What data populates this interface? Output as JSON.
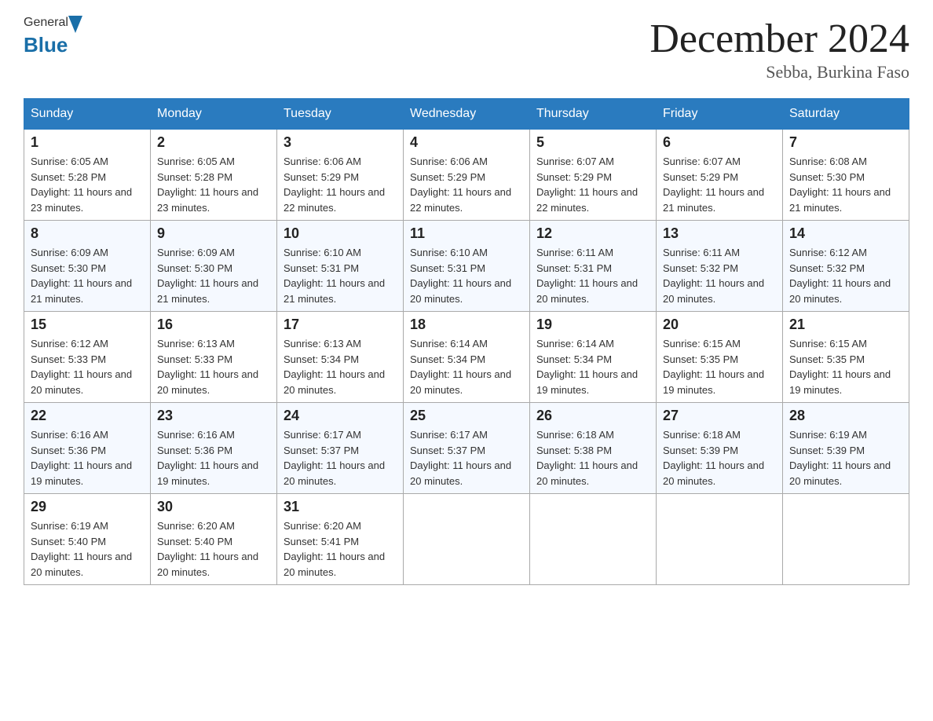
{
  "header": {
    "logo_general": "General",
    "logo_blue": "Blue",
    "month_title": "December 2024",
    "location": "Sebba, Burkina Faso"
  },
  "weekdays": [
    "Sunday",
    "Monday",
    "Tuesday",
    "Wednesday",
    "Thursday",
    "Friday",
    "Saturday"
  ],
  "weeks": [
    [
      {
        "day": "1",
        "sunrise": "Sunrise: 6:05 AM",
        "sunset": "Sunset: 5:28 PM",
        "daylight": "Daylight: 11 hours and 23 minutes."
      },
      {
        "day": "2",
        "sunrise": "Sunrise: 6:05 AM",
        "sunset": "Sunset: 5:28 PM",
        "daylight": "Daylight: 11 hours and 23 minutes."
      },
      {
        "day": "3",
        "sunrise": "Sunrise: 6:06 AM",
        "sunset": "Sunset: 5:29 PM",
        "daylight": "Daylight: 11 hours and 22 minutes."
      },
      {
        "day": "4",
        "sunrise": "Sunrise: 6:06 AM",
        "sunset": "Sunset: 5:29 PM",
        "daylight": "Daylight: 11 hours and 22 minutes."
      },
      {
        "day": "5",
        "sunrise": "Sunrise: 6:07 AM",
        "sunset": "Sunset: 5:29 PM",
        "daylight": "Daylight: 11 hours and 22 minutes."
      },
      {
        "day": "6",
        "sunrise": "Sunrise: 6:07 AM",
        "sunset": "Sunset: 5:29 PM",
        "daylight": "Daylight: 11 hours and 21 minutes."
      },
      {
        "day": "7",
        "sunrise": "Sunrise: 6:08 AM",
        "sunset": "Sunset: 5:30 PM",
        "daylight": "Daylight: 11 hours and 21 minutes."
      }
    ],
    [
      {
        "day": "8",
        "sunrise": "Sunrise: 6:09 AM",
        "sunset": "Sunset: 5:30 PM",
        "daylight": "Daylight: 11 hours and 21 minutes."
      },
      {
        "day": "9",
        "sunrise": "Sunrise: 6:09 AM",
        "sunset": "Sunset: 5:30 PM",
        "daylight": "Daylight: 11 hours and 21 minutes."
      },
      {
        "day": "10",
        "sunrise": "Sunrise: 6:10 AM",
        "sunset": "Sunset: 5:31 PM",
        "daylight": "Daylight: 11 hours and 21 minutes."
      },
      {
        "day": "11",
        "sunrise": "Sunrise: 6:10 AM",
        "sunset": "Sunset: 5:31 PM",
        "daylight": "Daylight: 11 hours and 20 minutes."
      },
      {
        "day": "12",
        "sunrise": "Sunrise: 6:11 AM",
        "sunset": "Sunset: 5:31 PM",
        "daylight": "Daylight: 11 hours and 20 minutes."
      },
      {
        "day": "13",
        "sunrise": "Sunrise: 6:11 AM",
        "sunset": "Sunset: 5:32 PM",
        "daylight": "Daylight: 11 hours and 20 minutes."
      },
      {
        "day": "14",
        "sunrise": "Sunrise: 6:12 AM",
        "sunset": "Sunset: 5:32 PM",
        "daylight": "Daylight: 11 hours and 20 minutes."
      }
    ],
    [
      {
        "day": "15",
        "sunrise": "Sunrise: 6:12 AM",
        "sunset": "Sunset: 5:33 PM",
        "daylight": "Daylight: 11 hours and 20 minutes."
      },
      {
        "day": "16",
        "sunrise": "Sunrise: 6:13 AM",
        "sunset": "Sunset: 5:33 PM",
        "daylight": "Daylight: 11 hours and 20 minutes."
      },
      {
        "day": "17",
        "sunrise": "Sunrise: 6:13 AM",
        "sunset": "Sunset: 5:34 PM",
        "daylight": "Daylight: 11 hours and 20 minutes."
      },
      {
        "day": "18",
        "sunrise": "Sunrise: 6:14 AM",
        "sunset": "Sunset: 5:34 PM",
        "daylight": "Daylight: 11 hours and 20 minutes."
      },
      {
        "day": "19",
        "sunrise": "Sunrise: 6:14 AM",
        "sunset": "Sunset: 5:34 PM",
        "daylight": "Daylight: 11 hours and 19 minutes."
      },
      {
        "day": "20",
        "sunrise": "Sunrise: 6:15 AM",
        "sunset": "Sunset: 5:35 PM",
        "daylight": "Daylight: 11 hours and 19 minutes."
      },
      {
        "day": "21",
        "sunrise": "Sunrise: 6:15 AM",
        "sunset": "Sunset: 5:35 PM",
        "daylight": "Daylight: 11 hours and 19 minutes."
      }
    ],
    [
      {
        "day": "22",
        "sunrise": "Sunrise: 6:16 AM",
        "sunset": "Sunset: 5:36 PM",
        "daylight": "Daylight: 11 hours and 19 minutes."
      },
      {
        "day": "23",
        "sunrise": "Sunrise: 6:16 AM",
        "sunset": "Sunset: 5:36 PM",
        "daylight": "Daylight: 11 hours and 19 minutes."
      },
      {
        "day": "24",
        "sunrise": "Sunrise: 6:17 AM",
        "sunset": "Sunset: 5:37 PM",
        "daylight": "Daylight: 11 hours and 20 minutes."
      },
      {
        "day": "25",
        "sunrise": "Sunrise: 6:17 AM",
        "sunset": "Sunset: 5:37 PM",
        "daylight": "Daylight: 11 hours and 20 minutes."
      },
      {
        "day": "26",
        "sunrise": "Sunrise: 6:18 AM",
        "sunset": "Sunset: 5:38 PM",
        "daylight": "Daylight: 11 hours and 20 minutes."
      },
      {
        "day": "27",
        "sunrise": "Sunrise: 6:18 AM",
        "sunset": "Sunset: 5:39 PM",
        "daylight": "Daylight: 11 hours and 20 minutes."
      },
      {
        "day": "28",
        "sunrise": "Sunrise: 6:19 AM",
        "sunset": "Sunset: 5:39 PM",
        "daylight": "Daylight: 11 hours and 20 minutes."
      }
    ],
    [
      {
        "day": "29",
        "sunrise": "Sunrise: 6:19 AM",
        "sunset": "Sunset: 5:40 PM",
        "daylight": "Daylight: 11 hours and 20 minutes."
      },
      {
        "day": "30",
        "sunrise": "Sunrise: 6:20 AM",
        "sunset": "Sunset: 5:40 PM",
        "daylight": "Daylight: 11 hours and 20 minutes."
      },
      {
        "day": "31",
        "sunrise": "Sunrise: 6:20 AM",
        "sunset": "Sunset: 5:41 PM",
        "daylight": "Daylight: 11 hours and 20 minutes."
      },
      null,
      null,
      null,
      null
    ]
  ]
}
